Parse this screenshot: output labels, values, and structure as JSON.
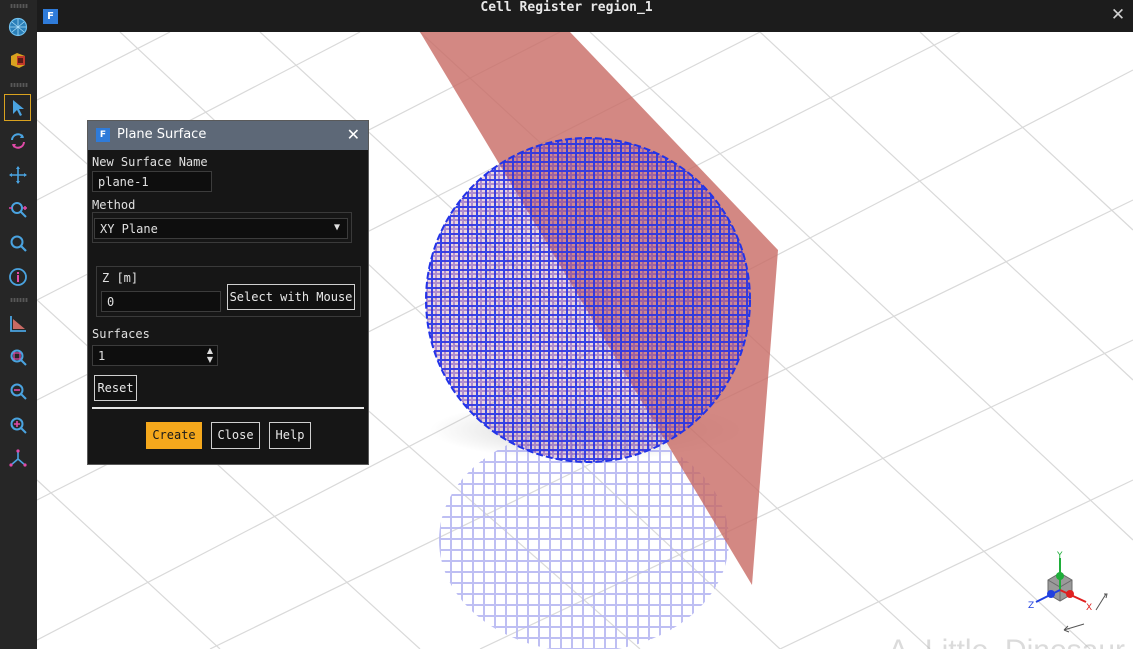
{
  "window": {
    "title": "Cell Register region_1",
    "logo_letter": "F",
    "close_glyph": "✕"
  },
  "toolbar": {
    "tools": [
      {
        "name": "mesh-sphere-icon",
        "active": false
      },
      {
        "name": "part-icon",
        "active": false
      },
      {
        "name": "select-cursor-icon",
        "active": true
      },
      {
        "name": "rotate-icon",
        "active": false
      },
      {
        "name": "pan-icon",
        "active": false
      },
      {
        "name": "zoom-plus-icon",
        "active": false
      },
      {
        "name": "zoom-icon",
        "active": false
      },
      {
        "name": "info-icon",
        "active": false
      },
      {
        "name": "plane-icon",
        "active": false
      },
      {
        "name": "zoom-box-icon",
        "active": false
      },
      {
        "name": "zoom-out-icon",
        "active": false
      },
      {
        "name": "zoom-fit-icon",
        "active": false
      },
      {
        "name": "axes-icon",
        "active": false
      }
    ]
  },
  "dialog": {
    "logo_letter": "F",
    "title": "Plane Surface",
    "close_glyph": "✕",
    "name_label": "New Surface Name",
    "name_value": "plane-1",
    "method_label": "Method",
    "method_value": "XY Plane",
    "z_label": "Z [m]",
    "z_value": "0",
    "select_mouse_label": "Select with Mouse",
    "surfaces_label": "Surfaces",
    "surfaces_value": "1",
    "reset_label": "Reset",
    "create_label": "Create",
    "close_label": "Close",
    "help_label": "Help"
  },
  "triad": {
    "x_label": "X",
    "y_label": "Y",
    "z_label": "Z"
  },
  "watermark": "A_Little_Dinosaur",
  "colors": {
    "accent": "#f5a81c",
    "plane": "#c86a64",
    "mesh": "#2233e8",
    "reflection": "#b7b8f2",
    "grid": "#d9d9d9"
  }
}
